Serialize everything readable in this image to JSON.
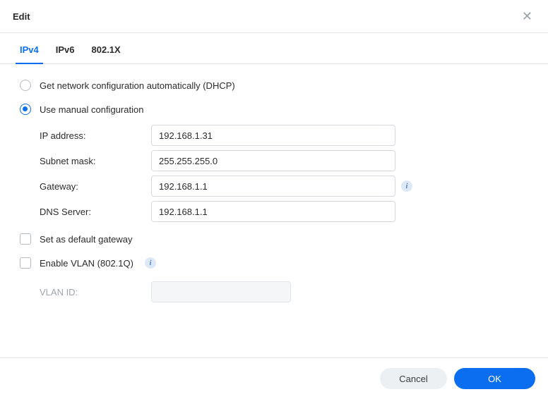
{
  "header": {
    "title": "Edit"
  },
  "tabs": {
    "ipv4": "IPv4",
    "ipv6": "IPv6",
    "dot1x": "802.1X"
  },
  "radio": {
    "dhcp": "Get network configuration automatically (DHCP)",
    "manual": "Use manual configuration"
  },
  "fields": {
    "ip_label": "IP address:",
    "ip_value": "192.168.1.31",
    "mask_label": "Subnet mask:",
    "mask_value": "255.255.255.0",
    "gw_label": "Gateway:",
    "gw_value": "192.168.1.1",
    "dns_label": "DNS Server:",
    "dns_value": "192.168.1.1"
  },
  "checkboxes": {
    "default_gw": "Set as default gateway",
    "vlan": "Enable VLAN (802.1Q)"
  },
  "vlan": {
    "id_label": "VLAN ID:"
  },
  "footer": {
    "cancel": "Cancel",
    "ok": "OK"
  }
}
